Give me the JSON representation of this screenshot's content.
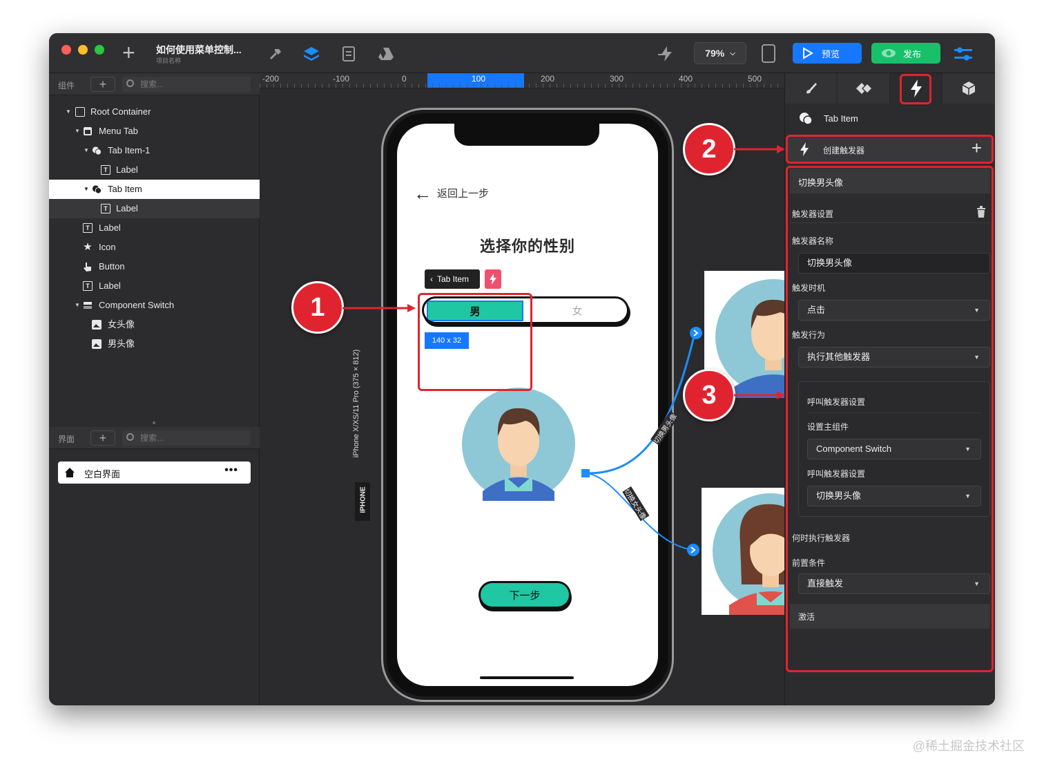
{
  "app": {
    "project_title": "如何使用菜单控制...",
    "project_subtitle": "项目名称",
    "zoom": "79%",
    "preview_label": "预览",
    "publish_label": "发布"
  },
  "layers_panel": {
    "title": "组件",
    "add": "+",
    "search_placeholder": "搜索...",
    "items": [
      {
        "label": "Root Container"
      },
      {
        "label": "Menu Tab"
      },
      {
        "label": "Tab Item-1"
      },
      {
        "label": "Label"
      },
      {
        "label": "Tab Item"
      },
      {
        "label": "Label"
      },
      {
        "label": "Label"
      },
      {
        "label": "Icon"
      },
      {
        "label": "Button"
      },
      {
        "label": "Label"
      },
      {
        "label": "Component Switch"
      },
      {
        "label": "女头像"
      },
      {
        "label": "男头像"
      }
    ]
  },
  "pages_panel": {
    "title": "界面",
    "add": "+",
    "search_placeholder": "搜索...",
    "page_label": "空白界面",
    "more": "•••"
  },
  "ruler": {
    "ticks": [
      "-200",
      "-100",
      "0",
      "100",
      "200",
      "300",
      "400",
      "500"
    ]
  },
  "canvas": {
    "back_label": "返回上一步",
    "screen_title": "选择你的性别",
    "tab_chip": "Tab Item",
    "switch_male": "男",
    "switch_female": "女",
    "size_badge": "140 x 32",
    "next_button": "下一步",
    "device_label": "iPhone X/XS/11 Pro (375 × 812)",
    "device_tag": "IPHONE",
    "connection_top": "切换男头像",
    "connection_bottom": "切换女头像"
  },
  "steps": [
    "1",
    "2",
    "3"
  ],
  "inspector": {
    "selected": "Tab Item",
    "create_trigger": "创建触发器",
    "trigger_name_header": "切换男头像",
    "trigger_settings": "触发器设置",
    "name_label": "触发器名称",
    "name_value": "切换男头像",
    "timing_label": "触发时机",
    "timing_value": "点击",
    "action_label": "触发行为",
    "action_value": "执行其他触发器",
    "call_settings_title": "呼叫触发器设置",
    "main_component_label": "设置主组件",
    "main_component_value": "Component Switch",
    "call_trigger_label": "呼叫触发器设置",
    "call_trigger_value": "切换男头像",
    "when_label": "何时执行触发器",
    "precondition_label": "前置条件",
    "precondition_value": "直接触发",
    "activate_label": "激活"
  },
  "watermark": "@稀土掘金技术社区",
  "colors": {
    "accent_blue": "#1677ff",
    "accent_green": "#18c06a",
    "annotation_red": "#e0242f",
    "teal": "#1fc7a3"
  }
}
